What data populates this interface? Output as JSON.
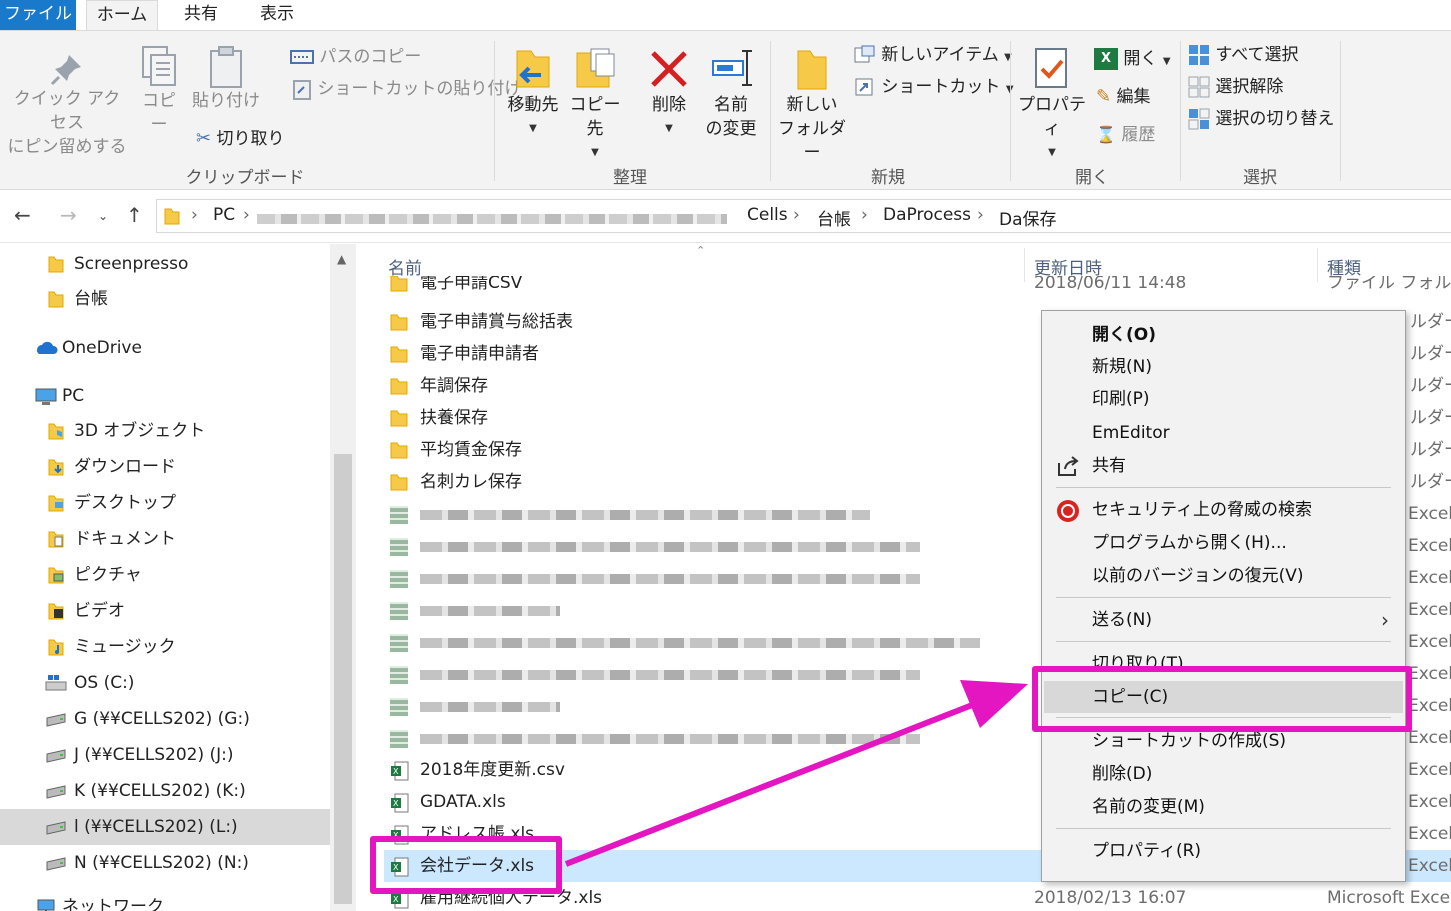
{
  "ribbon_tabs": {
    "file": "ファイル",
    "home": "ホーム",
    "share": "共有",
    "view": "表示"
  },
  "clipboard": {
    "pin_line1": "クイック アクセス",
    "pin_line2": "にピン留めする",
    "copy": "コピー",
    "paste": "貼り付け",
    "copy_path": "パスのコピー",
    "paste_shortcut": "ショートカットの貼り付け",
    "cut": "切り取り",
    "group": "クリップボード"
  },
  "organize": {
    "move_to": "移動先",
    "copy_to": "コピー先",
    "delete": "削除",
    "rename_line1": "名前",
    "rename_line2": "の変更",
    "group": "整理"
  },
  "new": {
    "new_folder_line1": "新しい",
    "new_folder_line2": "フォルダー",
    "new_item": "新しいアイテム",
    "shortcut": "ショートカット",
    "group": "新規"
  },
  "open": {
    "properties": "プロパティ",
    "open": "開く",
    "edit": "編集",
    "history": "履歴",
    "group": "開く"
  },
  "select": {
    "select_all": "すべて選択",
    "select_none": "選択解除",
    "invert": "選択の切り替え",
    "group": "選択"
  },
  "address": {
    "pc": "PC",
    "crumbs": [
      "Cells",
      "台帳",
      "DaProcess",
      "Da保存"
    ]
  },
  "nav_pane": {
    "items": [
      "Screenpresso",
      "台帳",
      "OneDrive",
      "PC",
      "3D オブジェクト",
      "ダウンロード",
      "デスクトップ",
      "ドキュメント",
      "ピクチャ",
      "ビデオ",
      "ミュージック",
      "OS (C:)",
      "G (¥¥CELLS202) (G:)",
      "J (¥¥CELLS202) (J:)",
      "K (¥¥CELLS202) (K:)",
      "l (¥¥CELLS202) (L:)",
      "N (¥¥CELLS202) (N:)",
      "ネットワーク"
    ]
  },
  "columns": {
    "name": "名前",
    "date": "更新日時",
    "type": "種類"
  },
  "files": {
    "folders": [
      {
        "name": "電子申請CSV",
        "date": "2018/06/11 14:48",
        "type": "ファイル フォルダー"
      },
      {
        "name": "電子申請賞与総括表",
        "type": "ルダー"
      },
      {
        "name": "電子申請申請者",
        "type": "ルダー"
      },
      {
        "name": "年調保存",
        "type": "ルダー"
      },
      {
        "name": "扶養保存",
        "type": "ルダー"
      },
      {
        "name": "平均賃金保存",
        "type": "ルダー"
      },
      {
        "name": "名刺カレ保存",
        "type": "ルダー"
      }
    ],
    "blurred_type": "Excel",
    "csv": {
      "name": "2018年度更新.csv",
      "type": "Excel"
    },
    "gdata": {
      "name": "GDATA.xls",
      "type": "Excel"
    },
    "address_book": {
      "name": "アドレス帳.xls",
      "type": "Excel"
    },
    "company": {
      "name": "会社データ.xls",
      "type": "Excel"
    },
    "employment": {
      "name": "雇用継続個人データ.xls",
      "date": "2018/02/13 16:07",
      "type": "Microsoft Excel"
    }
  },
  "context_menu": {
    "open": "開く(O)",
    "new": "新規(N)",
    "print": "印刷(P)",
    "emeditor": "EmEditor",
    "share": "共有",
    "security_scan": "セキュリティ上の脅威の検索",
    "open_with": "プログラムから開く(H)...",
    "restore": "以前のバージョンの復元(V)",
    "send_to": "送る(N)",
    "cut": "切り取り(T)",
    "copy": "コピー(C)",
    "create_shortcut": "ショートカットの作成(S)",
    "delete": "削除(D)",
    "rename": "名前の変更(M)",
    "properties": "プロパティ(R)"
  },
  "colors": {
    "highlight": "#e316c2",
    "file_tab": "#1979ca",
    "selection": "#cce8ff"
  }
}
